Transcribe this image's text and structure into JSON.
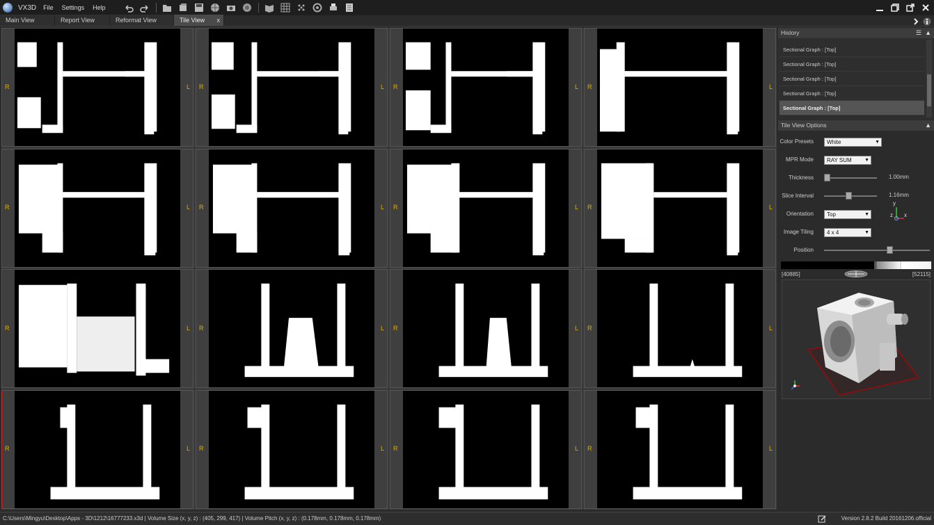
{
  "app": {
    "name": "VX3D"
  },
  "menu": [
    "File",
    "Settings",
    "Help"
  ],
  "toolbar": [
    "undo-icon",
    "redo-icon",
    "open-folder-icon",
    "open-volume-icon",
    "save-icon",
    "sphere-icon",
    "camera-icon",
    "globe-icon",
    "book-icon",
    "grid-icon",
    "dots-icon",
    "rotate-icon",
    "print-icon",
    "document-icon"
  ],
  "tabs": [
    {
      "label": "Main View",
      "active": false
    },
    {
      "label": "Report View",
      "active": false
    },
    {
      "label": "Reformat View",
      "active": false
    },
    {
      "label": "Tile View",
      "active": true,
      "close": "x"
    }
  ],
  "tiles": {
    "left_label": "R",
    "right_label": "L",
    "rows": 4,
    "cols": 4,
    "selected_index": 12
  },
  "history": {
    "title": "History",
    "items": [
      {
        "label": "Sectional Graph : [Top]",
        "selected": false
      },
      {
        "label": "Sectional Graph : [Top]",
        "selected": false
      },
      {
        "label": "Sectional Graph : [Top]",
        "selected": false
      },
      {
        "label": "Sectional Graph : [Top]",
        "selected": false
      },
      {
        "label": "Sectional Graph : [Top]",
        "selected": true
      }
    ]
  },
  "tile_options": {
    "title": "Tile View Options",
    "color_presets": {
      "label": "Color Presets",
      "value": "White"
    },
    "mpr_mode": {
      "label": "MPR Mode",
      "value": "RAY SUM"
    },
    "thickness": {
      "label": "Thickness",
      "value": "1.00mm",
      "level": 0.0
    },
    "slice_interval": {
      "label": "Slice Interval",
      "value": "1.16mm",
      "level": 0.46
    },
    "orientation": {
      "label": "Orientation",
      "value": "Top"
    },
    "image_tiling": {
      "label": "Image Tiling",
      "value": "4 x 4"
    },
    "position": {
      "label": "Position",
      "level": 0.62
    },
    "axes": {
      "y": "y",
      "z": "z",
      "x": "x"
    },
    "window_min": "[40885]",
    "window_max": "[52115]"
  },
  "status": {
    "text": "C:\\Users\\Mingyu\\Desktop\\Apps - 3D\\1212\\16777233.x3d  |  Volume Size (x, y, z) : (405, 299, 417)  |  Volume Pitch (x, y, z) : (0.178mm, 0.178mm, 0.178mm)",
    "version": "Version 2.8.2 Build 20161206.official"
  },
  "colors": {
    "selected_border": "#c42b2b",
    "orientation_label": "#e0b000",
    "background": "#2b2b2b"
  }
}
